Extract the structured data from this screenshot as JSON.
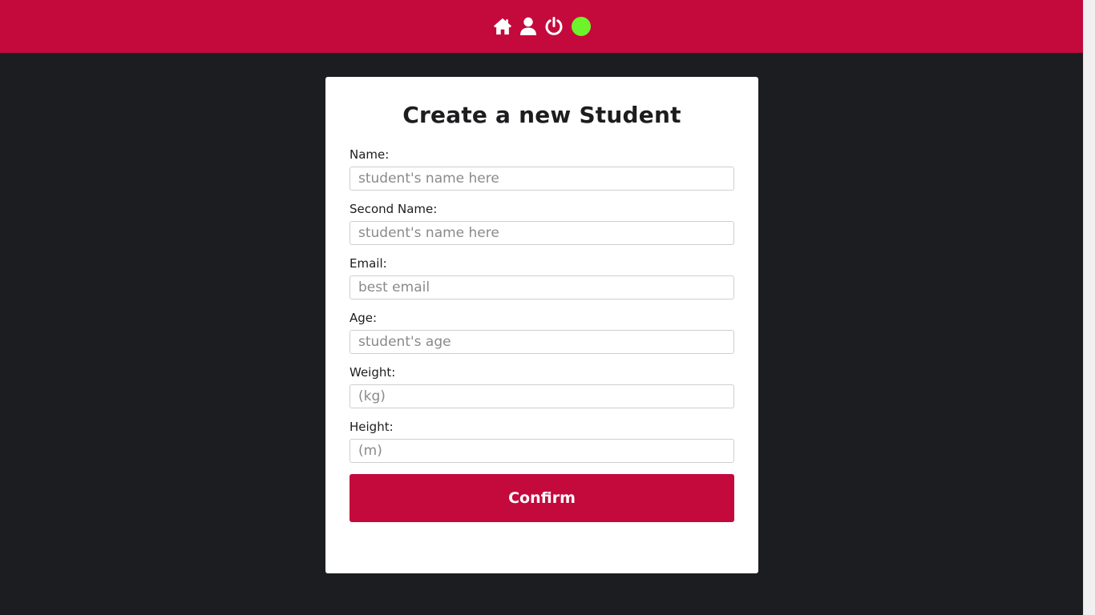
{
  "header": {
    "accent_color": "#c4093d",
    "icons": [
      "home-icon",
      "user-icon",
      "power-icon"
    ],
    "status_color": "#6cf32a"
  },
  "form": {
    "title": "Create a new Student",
    "fields": [
      {
        "label": "Name:",
        "placeholder": "student's name here",
        "value": ""
      },
      {
        "label": "Second Name:",
        "placeholder": "student's name here",
        "value": ""
      },
      {
        "label": "Email:",
        "placeholder": "best email",
        "value": ""
      },
      {
        "label": "Age:",
        "placeholder": "student's age",
        "value": ""
      },
      {
        "label": "Weight:",
        "placeholder": "(kg)",
        "value": ""
      },
      {
        "label": "Height:",
        "placeholder": "(m)",
        "value": ""
      }
    ],
    "confirm_label": "Confirm"
  }
}
